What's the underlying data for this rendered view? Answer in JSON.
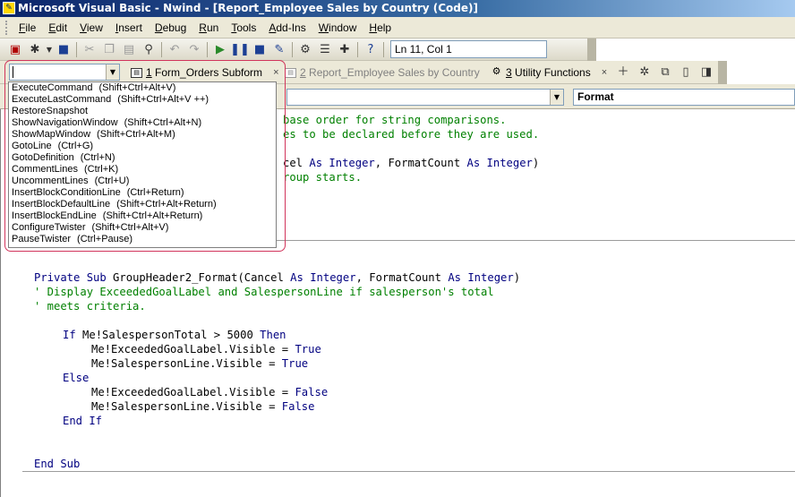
{
  "window": {
    "title": "Microsoft Visual Basic - Nwind - [Report_Employee Sales by Country (Code)]"
  },
  "menu": [
    {
      "u": "F",
      "rest": "ile"
    },
    {
      "u": "E",
      "rest": "dit"
    },
    {
      "u": "V",
      "rest": "iew"
    },
    {
      "u": "I",
      "rest": "nsert"
    },
    {
      "u": "D",
      "rest": "ebug"
    },
    {
      "u": "R",
      "rest": "un"
    },
    {
      "u": "T",
      "rest": "ools"
    },
    {
      "u": "A",
      "rest": "dd-Ins"
    },
    {
      "u": "W",
      "rest": "indow"
    },
    {
      "u": "H",
      "rest": "elp"
    }
  ],
  "toolbar": {
    "position": "Ln 11, Col 1"
  },
  "tabs": {
    "tab1": {
      "num": "1",
      "label": " Form_Orders Subform"
    },
    "tab2": {
      "num": "2",
      "label": " Report_Employee Sales by Country"
    },
    "tab3": {
      "num": "3",
      "label": " Utility Functions"
    }
  },
  "procedure_combo": "Format",
  "commands": [
    {
      "name": "ExecuteCommand",
      "shortcut": "(Shift+Ctrl+Alt+V)"
    },
    {
      "name": "ExecuteLastCommand",
      "shortcut": "(Shift+Ctrl+Alt+V ++)"
    },
    {
      "name": "RestoreSnapshot",
      "shortcut": ""
    },
    {
      "name": "ShowNavigationWindow",
      "shortcut": "(Shift+Ctrl+Alt+N)"
    },
    {
      "name": "ShowMapWindow",
      "shortcut": "(Shift+Ctrl+Alt+M)"
    },
    {
      "name": "GotoLine",
      "shortcut": "(Ctrl+G)"
    },
    {
      "name": "GotoDefinition",
      "shortcut": "(Ctrl+N)"
    },
    {
      "name": "CommentLines",
      "shortcut": "(Ctrl+K)"
    },
    {
      "name": "UncommentLines",
      "shortcut": "(Ctrl+U)"
    },
    {
      "name": "InsertBlockConditionLine",
      "shortcut": "(Ctrl+Return)"
    },
    {
      "name": "InsertBlockDefaultLine",
      "shortcut": "(Shift+Ctrl+Alt+Return)"
    },
    {
      "name": "InsertBlockEndLine",
      "shortcut": "(Shift+Ctrl+Alt+Return)"
    },
    {
      "name": "ConfigureTwister",
      "shortcut": "(Shift+Ctrl+Alt+V)"
    },
    {
      "name": "PauseTwister",
      "shortcut": "(Ctrl+Pause)"
    }
  ],
  "code": {
    "l1": "base order for string comparisons.",
    "l2": "es to be declared before they are used.",
    "l3a": "cel ",
    "l3b": "As",
    "l3c": " ",
    "l3d": "Integer",
    "l3e": ", FormatCount ",
    "l3f": "As",
    "l3g": " ",
    "l3h": "Integer",
    "l3i": ")",
    "l4": "roup starts.",
    "m1a": "Private Sub",
    "m1b": " GroupHeader2_Format(Cancel ",
    "m1c": "As",
    "m1d": " ",
    "m1e": "Integer",
    "m1f": ", FormatCount ",
    "m1g": "As",
    "m1h": " ",
    "m1i": "Integer",
    "m1j": ")",
    "m2": "' Display ExceededGoalLabel and SalespersonLine if salesperson's total",
    "m3": "' meets criteria.",
    "m4a": "If",
    "m4b": " Me!SalespersonTotal > 5000 ",
    "m4c": "Then",
    "m5a": "Me!ExceededGoalLabel.Visible = ",
    "m5b": "True",
    "m6a": "Me!SalespersonLine.Visible = ",
    "m6b": "True",
    "m7": "Else",
    "m8a": "Me!ExceededGoalLabel.Visible = ",
    "m8b": "False",
    "m9a": "Me!SalespersonLine.Visible = ",
    "m9b": "False",
    "m10": "End If",
    "m11": "End Sub"
  }
}
